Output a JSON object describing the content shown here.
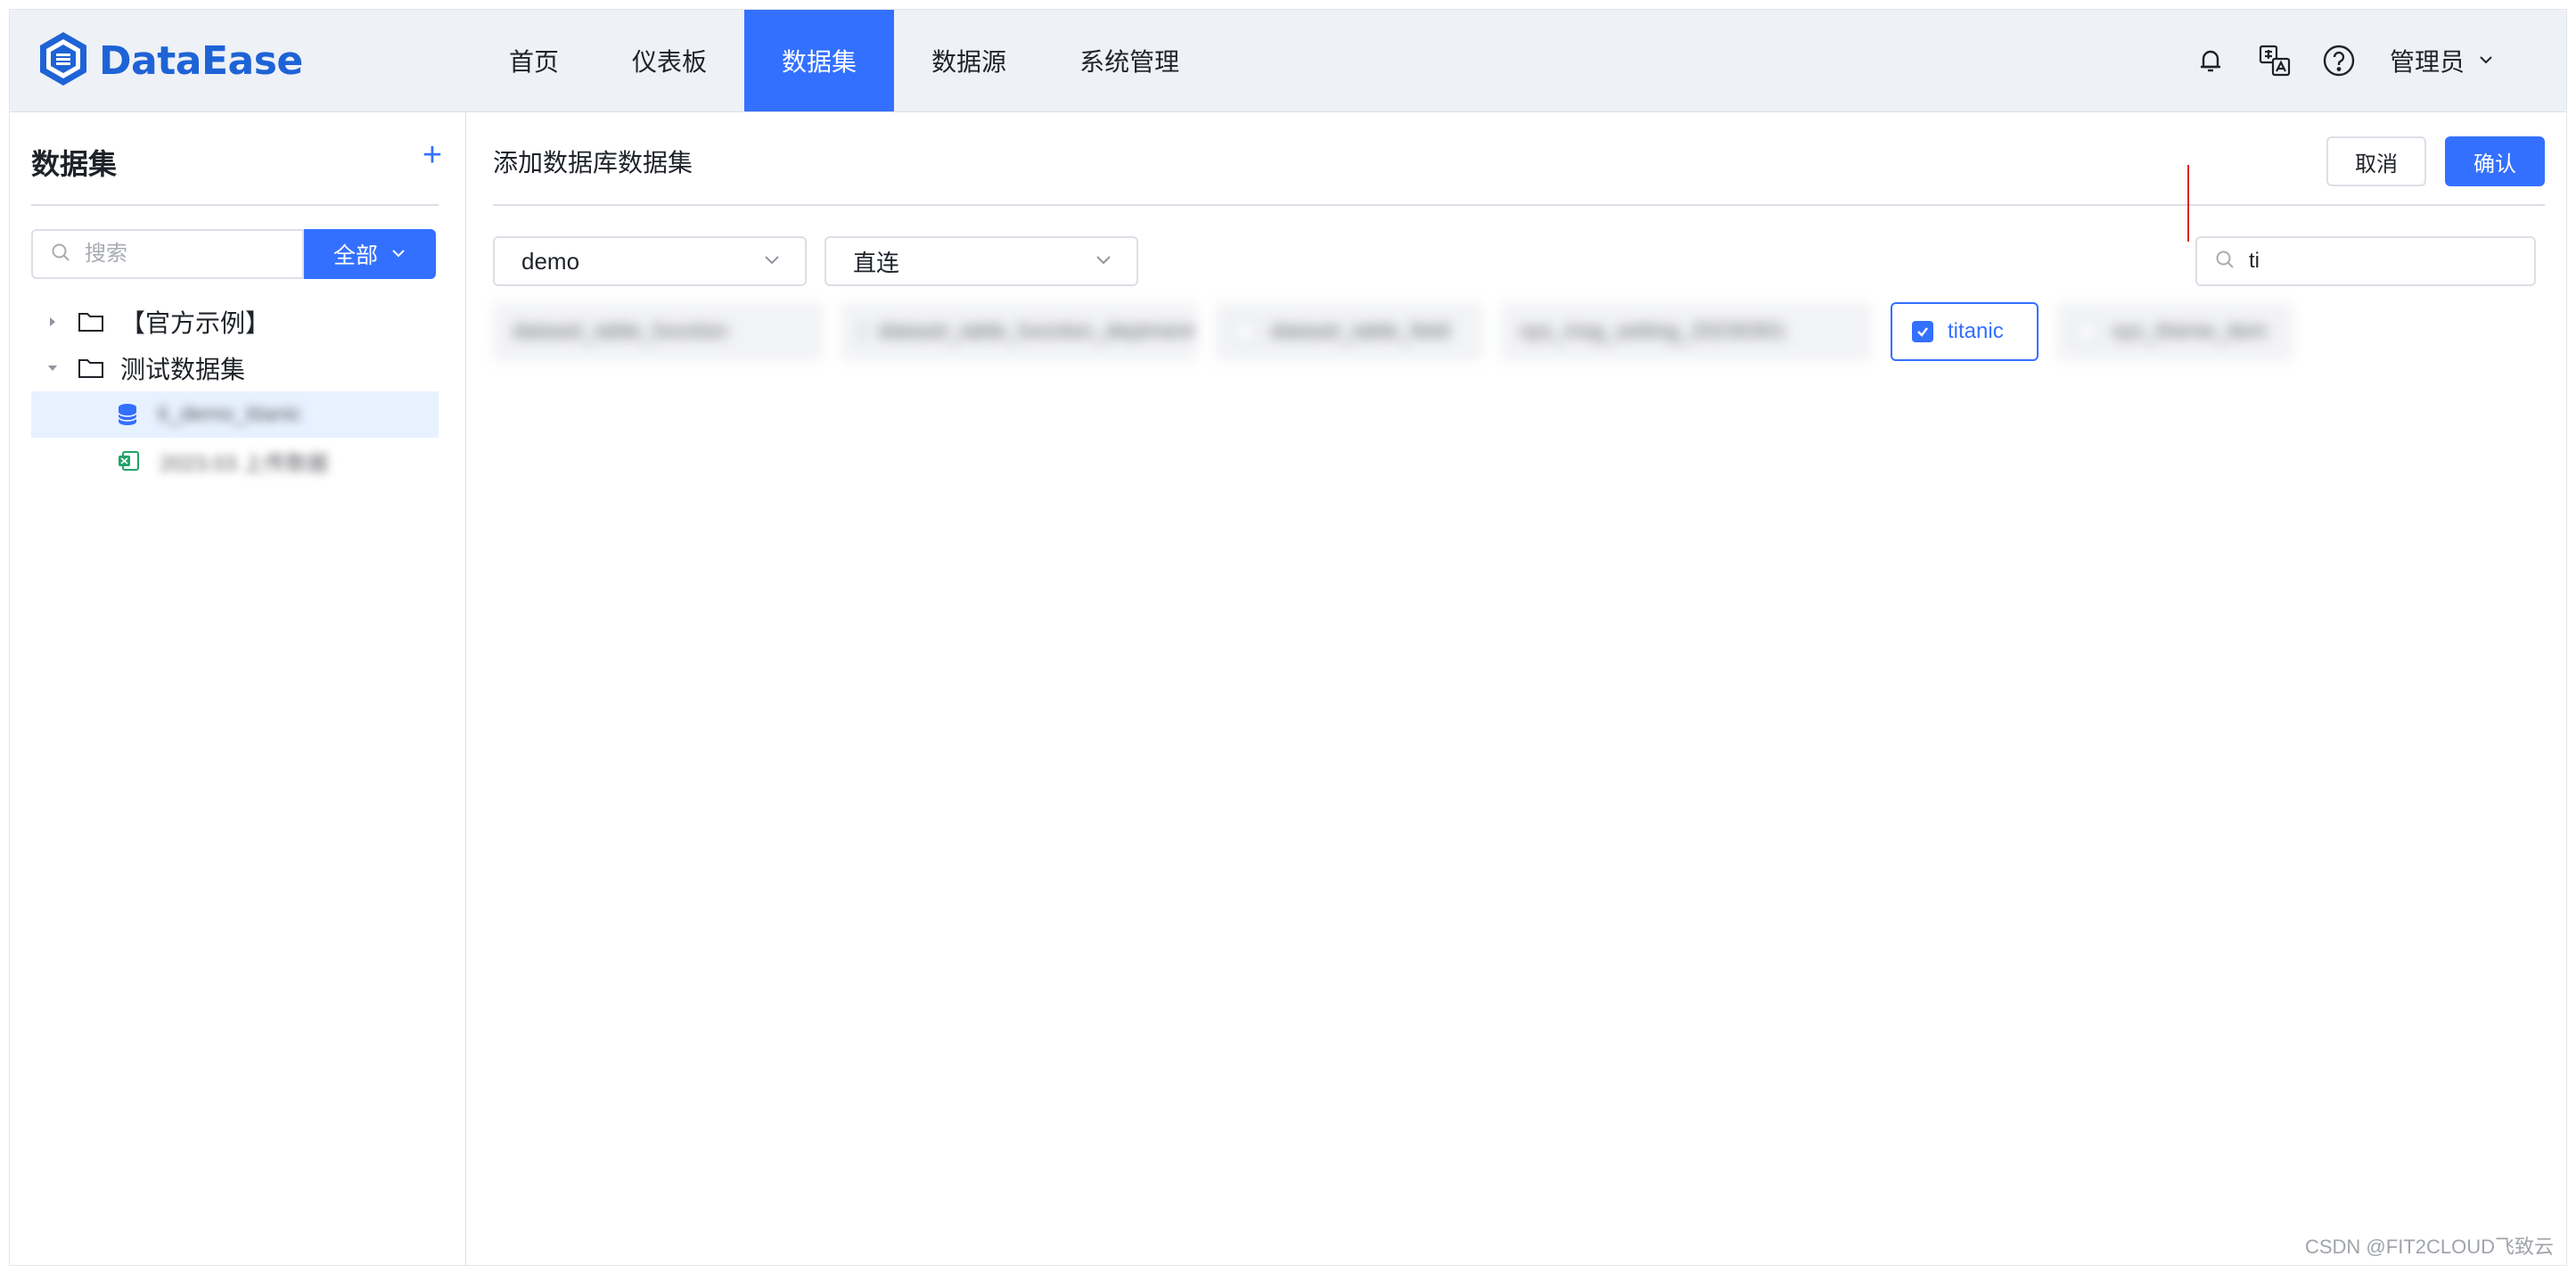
{
  "app": {
    "logo_text": "DataEase"
  },
  "nav": {
    "items": [
      {
        "label": "首页",
        "active": false
      },
      {
        "label": "仪表板",
        "active": false
      },
      {
        "label": "数据集",
        "active": true
      },
      {
        "label": "数据源",
        "active": false
      },
      {
        "label": "系统管理",
        "active": false
      }
    ]
  },
  "header": {
    "icons": [
      "bell-icon",
      "translate-icon",
      "help-icon"
    ],
    "user_label": "管理员"
  },
  "sidebar": {
    "title": "数据集",
    "add_glyph": "+",
    "search": {
      "placeholder": "搜索",
      "value": ""
    },
    "filter_label": "全部",
    "tree": [
      {
        "label": "【官方示例】",
        "expanded": false,
        "icon": "folder-icon"
      },
      {
        "label": "测试数据集",
        "expanded": true,
        "icon": "folder-icon",
        "children": [
          {
            "label": "ti_demo_titanic",
            "icon": "database-icon",
            "selected": true,
            "obscured": true
          },
          {
            "label": "2023.03 上传数据",
            "icon": "excel-icon",
            "selected": false,
            "obscured": true
          }
        ]
      }
    ]
  },
  "main": {
    "title": "添加数据库数据集",
    "cancel_label": "取消",
    "confirm_label": "确认",
    "datasource_select": "demo",
    "mode_select": "直连",
    "table_search": {
      "placeholder": "",
      "value": "ti"
    },
    "tables": [
      {
        "label": "dataset_table_function",
        "checked": false,
        "obscured": true
      },
      {
        "label": "dataset_table_function_deptment",
        "checked": false,
        "obscured": true
      },
      {
        "label": "dataset_table_field",
        "checked": false,
        "obscured": true
      },
      {
        "label": "sys_msg_setting_20230301",
        "checked": false,
        "obscured": true
      },
      {
        "label": "titanic",
        "checked": true,
        "obscured": false
      },
      {
        "label": "sys_theme_item",
        "checked": false,
        "obscured": true
      }
    ]
  },
  "watermark": "CSDN @FIT2CLOUD飞致云",
  "colors": {
    "accent": "#3370ff",
    "header_bg": "#eef1f6",
    "selected_bg": "#e8f1ff",
    "excel_green": "#21a366"
  }
}
